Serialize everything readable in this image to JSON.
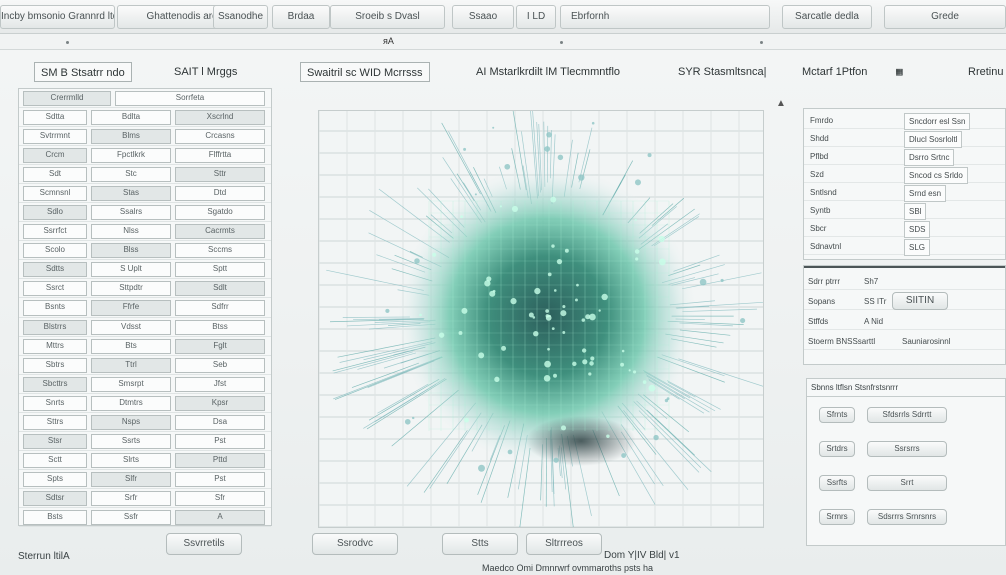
{
  "tabs": [
    "Incby bmsonio Grannrd ltdl",
    "Ghattenodis ard GD",
    "Ssanodhe",
    "Brdaa",
    "Sroeib s Dvasl",
    "Ssaao",
    "I LD",
    "Ebrfornh",
    "Sarcatle dedla",
    "Grede"
  ],
  "subbar": {
    "mark": "ᴙA"
  },
  "menu": {
    "m1": "SM B Stsatrr ndo",
    "m2": "SAIT l Mrggs",
    "m3": "Swaitril sc WID Mcrrsss",
    "m4": "AI Mstarlkrdilt lM Tlecmmntflo",
    "m5": "SYR Stasmltsnca|",
    "m6": "Mctarf 1Ptfon",
    "m7": "Rretinu"
  },
  "left_panel": {
    "rows": [
      [
        "Crerrmlld",
        "Sorrfeta"
      ],
      [
        "Sdtta",
        "Bdlta",
        "Xscrlnd"
      ],
      [
        "Svtrrmnt",
        "Blms",
        "Crcasns"
      ],
      [
        "Crcm",
        "Fpctlkrk",
        "Flffrtta"
      ],
      [
        "Sdt",
        "Stc",
        "Sttr"
      ],
      [
        "Scmnsnl",
        "Stas",
        "Dtd"
      ],
      [
        "Sdlo",
        "Ssalrs",
        "Sgatdo"
      ],
      [
        "Ssrrfct",
        "Nlss",
        "Cacrmts"
      ],
      [
        "Scolo",
        "Blss",
        "Sccms"
      ],
      [
        "Sdtts",
        "S Uplt",
        "Sptt"
      ],
      [
        "Ssrct",
        "Sttpdtr",
        "Sdlt"
      ],
      [
        "Bsnts",
        "Ffrfe",
        "Sdfrr"
      ],
      [
        "Blstrrs",
        "Vdsst",
        "Btss"
      ],
      [
        "Mttrs",
        "Bts",
        "Fglt"
      ],
      [
        "Sbtrs",
        "Ttrl",
        "Seb"
      ],
      [
        "Sbcttrs",
        "Smsrpt",
        "Jfst"
      ],
      [
        "Snrts",
        "Dtmtrs",
        "Kpsr"
      ],
      [
        "Sttrs",
        "Nsps",
        "Dsa"
      ],
      [
        "Stsr",
        "Ssrts",
        "Pst"
      ],
      [
        "Sctt",
        "Slrts",
        "Pttd"
      ],
      [
        "Spts",
        "Slfr",
        "Pst"
      ],
      [
        "Sdtsr",
        "Srfr",
        "Sfr"
      ],
      [
        "Bsts",
        "Ssfr",
        "A"
      ]
    ]
  },
  "right_panel": {
    "top_rows": [
      [
        "Fmrdo",
        "Sncdorr esl Ssn"
      ],
      [
        "Shdd",
        "Dlucl Sosrloltl"
      ],
      [
        "Pflbd",
        "Dsrro Srtnc"
      ],
      [
        "Szd",
        "Sncod cs Srldo"
      ],
      [
        "Sntlsnd",
        "Srnd esn"
      ],
      [
        "Syntb",
        "SBl"
      ],
      [
        "Sbcr",
        "SDS"
      ],
      [
        "Sdnavtnl",
        "SLG"
      ]
    ],
    "mid_rows": [
      [
        "Sdrr ptrrr",
        "Sh7"
      ],
      [
        "Sopans",
        "SS ITr"
      ],
      [
        "Stffds",
        "A Nid"
      ],
      [
        "Stoerm BNSSsarttl",
        "Sauniarosinnl"
      ]
    ],
    "mid_button": "SIITIN",
    "bottom_header": "Sbnns ltflsn Stsnfrstsnrrr",
    "bottom_items": [
      "Sfrnts",
      "Sfdsrrls Sdrrtt",
      "Srtdrs",
      "Ssrsrrs",
      "Ssrfts",
      "Srrt",
      "Srmrs",
      "Sdsrrrs Srnrsnrs"
    ]
  },
  "bottom": {
    "left_label": "Sterrun ltilA",
    "btn1": "Ssvrretils",
    "btn2": "Ssrodvc",
    "btn3": "Stts",
    "btn4": "Sltrrreos",
    "footer_right": "Dom Y|IV Bld| v1",
    "footer_center": "Maedco Omi Dmnrwrf ovmmaroths psts ha"
  },
  "colors": {
    "accent": "#3fae9a",
    "viz_core": "#1c3a3f",
    "viz_glow": "#6fd3b8",
    "panel_bg": "#f6f8f8"
  }
}
